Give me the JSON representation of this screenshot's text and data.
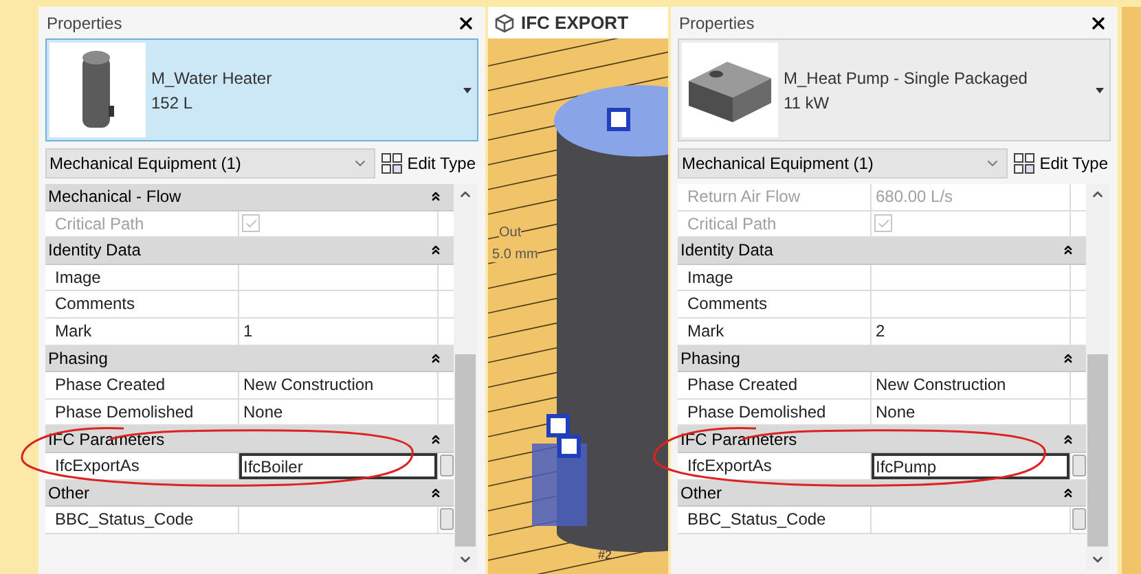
{
  "panels": [
    {
      "title": "Properties",
      "kind": "cylinder",
      "family": "M_Water Heater",
      "type": "152 L",
      "selected": true,
      "category": "Mechanical Equipment (1)",
      "edit_type": "Edit Type",
      "rows": [
        {
          "kind": "group",
          "label": "Mechanical - Flow"
        },
        {
          "kind": "checkbox",
          "label": "Critical Path",
          "checked": true,
          "disabled": true
        },
        {
          "kind": "group",
          "label": "Identity Data"
        },
        {
          "kind": "text",
          "label": "Image"
        },
        {
          "kind": "text",
          "label": "Comments"
        },
        {
          "kind": "text",
          "label": "Mark",
          "value": "1"
        },
        {
          "kind": "group",
          "label": "Phasing"
        },
        {
          "kind": "text",
          "label": "Phase Created",
          "value": "New Construction"
        },
        {
          "kind": "text",
          "label": "Phase Demolished",
          "value": "None"
        },
        {
          "kind": "group",
          "label": "IFC Parameters"
        },
        {
          "kind": "text",
          "label": "IfcExportAs",
          "value": "IfcBoiler",
          "editing": true,
          "side_button": true
        },
        {
          "kind": "group",
          "label": "Other"
        },
        {
          "kind": "text",
          "label": "BBC_Status_Code",
          "side_button": true
        }
      ]
    },
    {
      "title": "Properties",
      "kind": "box",
      "family": "M_Heat Pump - Single Packaged",
      "type": "11 kW",
      "selected": false,
      "category": "Mechanical Equipment (1)",
      "edit_type": "Edit Type",
      "rows": [
        {
          "kind": "text",
          "label": "Return Air Flow",
          "value": "680.00 L/s",
          "disabled": true
        },
        {
          "kind": "checkbox",
          "label": "Critical Path",
          "checked": true,
          "disabled": true
        },
        {
          "kind": "group",
          "label": "Identity Data"
        },
        {
          "kind": "text",
          "label": "Image"
        },
        {
          "kind": "text",
          "label": "Comments"
        },
        {
          "kind": "text",
          "label": "Mark",
          "value": "2"
        },
        {
          "kind": "group",
          "label": "Phasing"
        },
        {
          "kind": "text",
          "label": "Phase Created",
          "value": "New Construction"
        },
        {
          "kind": "text",
          "label": "Phase Demolished",
          "value": "None"
        },
        {
          "kind": "group",
          "label": "IFC Parameters"
        },
        {
          "kind": "text",
          "label": "IfcExportAs",
          "value": "IfcPump",
          "editing": true,
          "side_button": true
        },
        {
          "kind": "group",
          "label": "Other"
        },
        {
          "kind": "text",
          "label": "BBC_Status_Code",
          "side_button": true
        }
      ]
    }
  ],
  "viewport": {
    "title": "IFC EXPORT",
    "labels": [
      "Out",
      "5.0 mm",
      "#2"
    ]
  }
}
